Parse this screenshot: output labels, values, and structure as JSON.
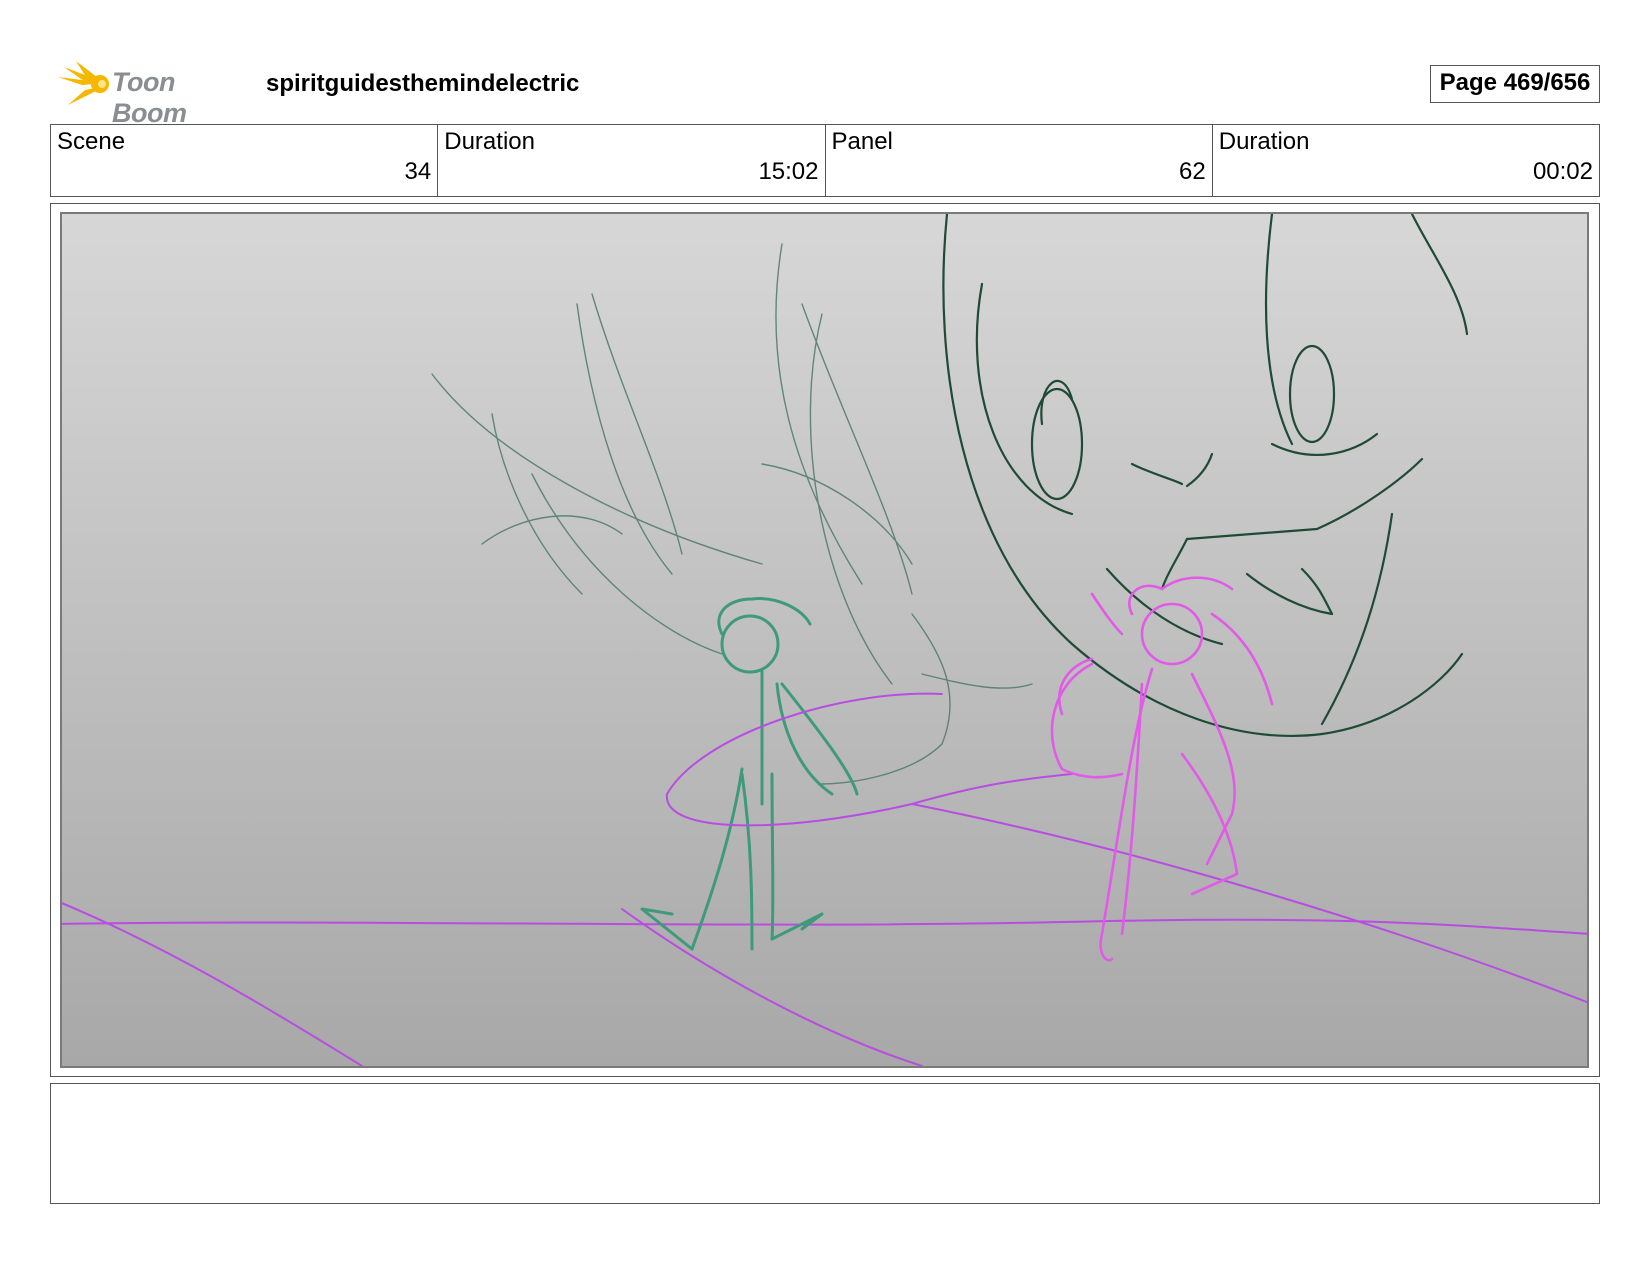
{
  "header": {
    "logo_text": "Toon Boom",
    "project_title": "spiritguidesthemindelectric",
    "page_label": "Page 469/656"
  },
  "info": {
    "scene_label": "Scene",
    "scene_value": "34",
    "scene_duration_label": "Duration",
    "scene_duration_value": "15:02",
    "panel_label": "Panel",
    "panel_value": "62",
    "panel_duration_label": "Duration",
    "panel_duration_value": "00:02"
  },
  "colors": {
    "logo_yellow": "#f5b700",
    "dark_green_line": "#1f4a36",
    "teal_character": "#3f9a7c",
    "magenta_character": "#e25ae8",
    "purple_ground": "#b84ee0"
  },
  "notes": {
    "text": ""
  }
}
